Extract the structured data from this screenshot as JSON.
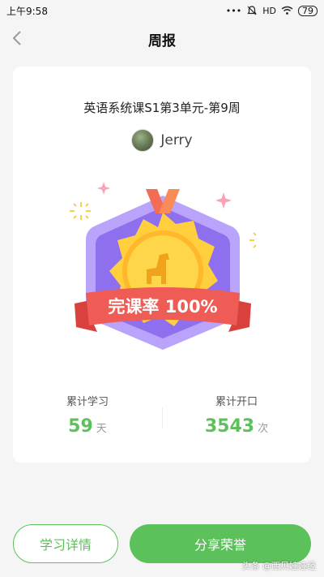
{
  "status_bar": {
    "time": "上午9:58",
    "signal": "•••",
    "network": "HD",
    "battery": "79"
  },
  "header": {
    "title": "周报"
  },
  "report": {
    "course_title": "英语系统课S1第3单元-第9周",
    "user_name": "Jerry",
    "badge_text": "完课率 100%",
    "stats": [
      {
        "label": "累计学习",
        "value": "59",
        "unit": "天"
      },
      {
        "label": "累计开口",
        "value": "3543",
        "unit": "次"
      }
    ]
  },
  "actions": {
    "details_label": "学习详情",
    "share_label": "分享荣誉"
  },
  "watermark": "头条 @西贝娃娃经",
  "colors": {
    "accent_green": "#5cc15a",
    "badge_purple": "#9b7cf3",
    "ribbon_red": "#ef5b55",
    "medal_gold": "#ffc533"
  }
}
